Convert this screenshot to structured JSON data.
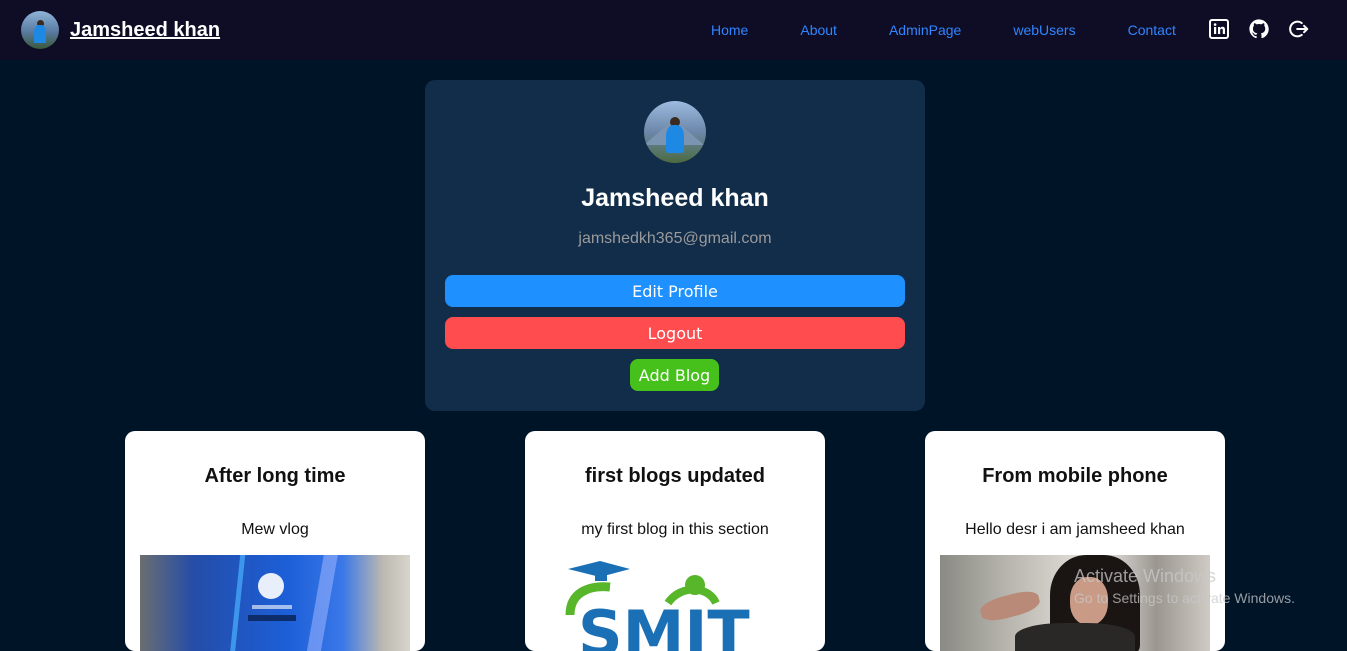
{
  "nav": {
    "brand": "Jamsheed khan",
    "links": [
      "Home",
      "About",
      "AdminPage",
      "webUsers",
      "Contact"
    ],
    "icons": [
      "linkedin-icon",
      "github-icon",
      "logout-icon"
    ]
  },
  "profile": {
    "name": "Jamsheed khan",
    "email": "jamshedkh365@gmail.com",
    "edit_label": "Edit Profile",
    "logout_label": "Logout",
    "add_blog_label": "Add Blog"
  },
  "blogs": [
    {
      "title": "After long time",
      "description": "Mew vlog"
    },
    {
      "title": "first blogs updated",
      "description": "my first blog in this section"
    },
    {
      "title": "From mobile phone",
      "description": "Hello desr i am jamsheed khan"
    }
  ],
  "logo_text": "SMIT",
  "watermark": {
    "line1": "Activate Windows",
    "line2": "Go to Settings to activate Windows."
  },
  "colors": {
    "background": "#001428",
    "navbar": "#0f0c26",
    "card": "#122d4a",
    "link": "#2f86ff",
    "edit_button": "#1e90ff",
    "logout_button": "#ff4c4f",
    "add_button": "#46c01a"
  }
}
